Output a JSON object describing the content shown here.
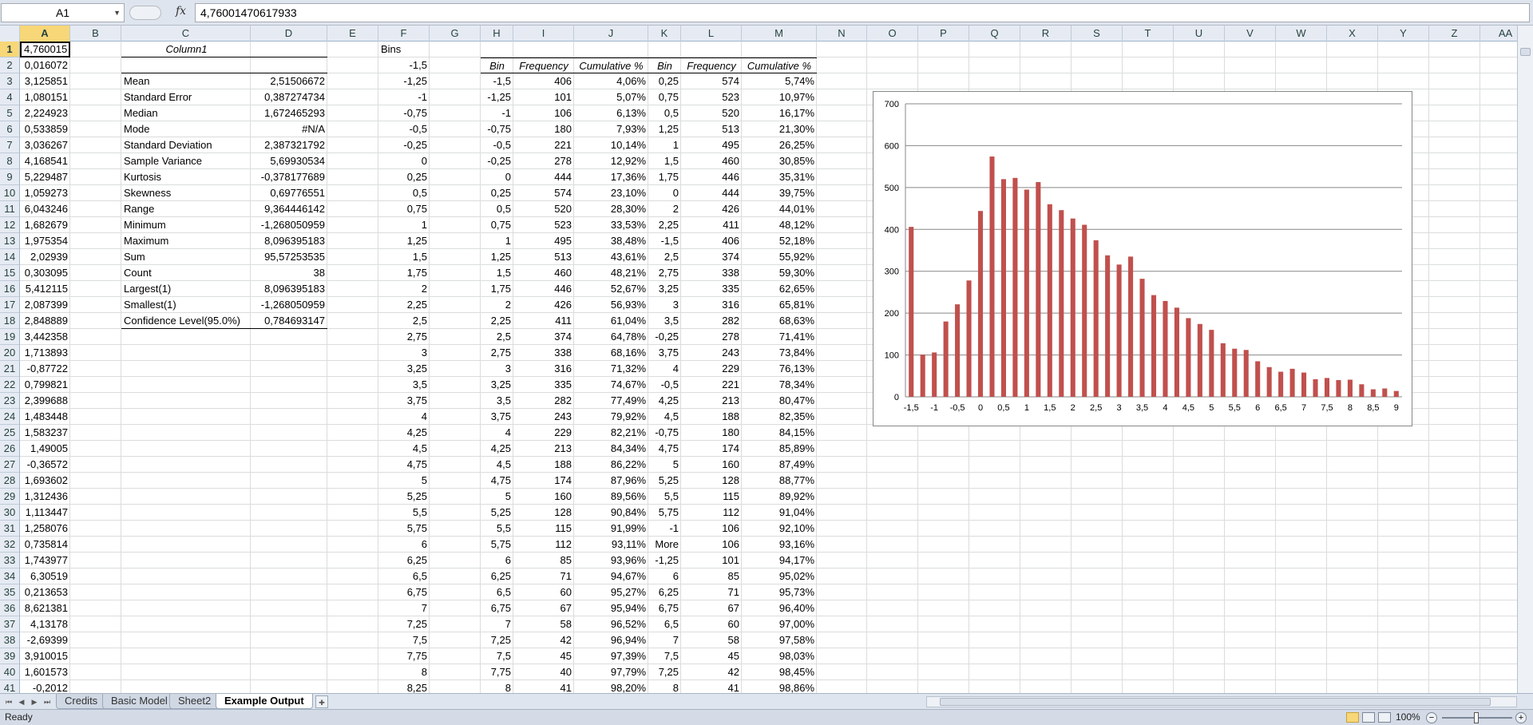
{
  "formula_bar": {
    "name_box": "A1",
    "fx_label": "fx",
    "formula": "4,76001470617933"
  },
  "columns": [
    "A",
    "B",
    "C",
    "D",
    "E",
    "F",
    "G",
    "H",
    "I",
    "J",
    "K",
    "L",
    "M",
    "N",
    "O",
    "P",
    "Q",
    "R",
    "S",
    "T",
    "U",
    "V",
    "W",
    "X",
    "Y",
    "Z",
    "AA"
  ],
  "rows": [
    "1",
    "2",
    "3",
    "4",
    "5",
    "6",
    "7",
    "8",
    "9",
    "10",
    "11",
    "12",
    "13",
    "14",
    "15",
    "16",
    "17",
    "18",
    "19",
    "20",
    "21",
    "22",
    "23",
    "24",
    "25",
    "26",
    "27",
    "28",
    "29",
    "30",
    "31",
    "32",
    "33",
    "34",
    "35",
    "36",
    "37",
    "38",
    "39",
    "40",
    "41"
  ],
  "colA": [
    "4,760015",
    "0,016072",
    "3,125851",
    "1,080151",
    "2,224923",
    "0,533859",
    "3,036267",
    "4,168541",
    "5,229487",
    "1,059273",
    "6,043246",
    "1,682679",
    "1,975354",
    "2,02939",
    "0,303095",
    "5,412115",
    "2,087399",
    "2,848889",
    "3,442358",
    "1,713893",
    "-0,87722",
    "0,799821",
    "2,399688",
    "1,483448",
    "1,583237",
    "1,49005",
    "-0,36572",
    "1,693602",
    "1,312436",
    "1,113447",
    "1,258076",
    "0,735814",
    "1,743977",
    "6,30519",
    "0,213653",
    "8,621381",
    "4,13178",
    "-2,69399",
    "3,910015",
    "1,601573",
    "-0,2012"
  ],
  "stats": {
    "header": "Column1",
    "labels": [
      "Mean",
      "Standard Error",
      "Median",
      "Mode",
      "Standard Deviation",
      "Sample Variance",
      "Kurtosis",
      "Skewness",
      "Range",
      "Minimum",
      "Maximum",
      "Sum",
      "Count",
      "Largest(1)",
      "Smallest(1)",
      "Confidence Level(95.0%)"
    ],
    "values": [
      "2,51506672",
      "0,387274734",
      "1,672465293",
      "#N/A",
      "2,387321792",
      "5,69930534",
      "-0,378177689",
      "0,69776551",
      "9,364446142",
      "-1,268050959",
      "8,096395183",
      "95,57253535",
      "38",
      "8,096395183",
      "-1,268050959",
      "0,784693147"
    ]
  },
  "bins": {
    "header": "Bins",
    "values": [
      "-1,5",
      "-1,25",
      "-1",
      "-0,75",
      "-0,5",
      "-0,25",
      "0",
      "0,25",
      "0,5",
      "0,75",
      "1",
      "1,25",
      "1,5",
      "1,75",
      "2",
      "2,25",
      "2,5",
      "2,75",
      "3",
      "3,25",
      "3,5",
      "3,75",
      "4",
      "4,25",
      "4,5",
      "4,75",
      "5",
      "5,25",
      "5,5",
      "5,75",
      "6",
      "6,25",
      "6,5",
      "6,75",
      "7",
      "7,25",
      "7,5",
      "7,75",
      "8",
      "8,25"
    ]
  },
  "hist1": {
    "headers": [
      "Bin",
      "Frequency",
      "Cumulative %"
    ],
    "bin": [
      "-1,5",
      "-1,25",
      "-1",
      "-0,75",
      "-0,5",
      "-0,25",
      "0",
      "0,25",
      "0,5",
      "0,75",
      "1",
      "1,25",
      "1,5",
      "1,75",
      "2",
      "2,25",
      "2,5",
      "2,75",
      "3",
      "3,25",
      "3,5",
      "3,75",
      "4",
      "4,25",
      "4,5",
      "4,75",
      "5",
      "5,25",
      "5,5",
      "5,75",
      "6",
      "6,25",
      "6,5",
      "6,75",
      "7",
      "7,25",
      "7,5",
      "7,75",
      "8"
    ],
    "freq": [
      "406",
      "101",
      "106",
      "180",
      "221",
      "278",
      "444",
      "574",
      "520",
      "523",
      "495",
      "513",
      "460",
      "446",
      "426",
      "411",
      "374",
      "338",
      "316",
      "335",
      "282",
      "243",
      "229",
      "213",
      "188",
      "174",
      "160",
      "128",
      "115",
      "112",
      "85",
      "71",
      "60",
      "67",
      "58",
      "42",
      "45",
      "40",
      "41"
    ],
    "cum": [
      "4,06%",
      "5,07%",
      "6,13%",
      "7,93%",
      "10,14%",
      "12,92%",
      "17,36%",
      "23,10%",
      "28,30%",
      "33,53%",
      "38,48%",
      "43,61%",
      "48,21%",
      "52,67%",
      "56,93%",
      "61,04%",
      "64,78%",
      "68,16%",
      "71,32%",
      "74,67%",
      "77,49%",
      "79,92%",
      "82,21%",
      "84,34%",
      "86,22%",
      "87,96%",
      "89,56%",
      "90,84%",
      "91,99%",
      "93,11%",
      "93,96%",
      "94,67%",
      "95,27%",
      "95,94%",
      "96,52%",
      "96,94%",
      "97,39%",
      "97,79%",
      "98,20%"
    ]
  },
  "hist2": {
    "headers": [
      "Bin",
      "Frequency",
      "Cumulative %"
    ],
    "bin": [
      "0,25",
      "0,75",
      "0,5",
      "1,25",
      "1",
      "1,5",
      "1,75",
      "0",
      "2",
      "2,25",
      "-1,5",
      "2,5",
      "2,75",
      "3,25",
      "3",
      "3,5",
      "-0,25",
      "3,75",
      "4",
      "-0,5",
      "4,25",
      "4,5",
      "-0,75",
      "4,75",
      "5",
      "5,25",
      "5,5",
      "5,75",
      "-1",
      "More",
      "-1,25",
      "6",
      "6,25",
      "6,75",
      "6,5",
      "7",
      "7,5",
      "7,25",
      "8"
    ],
    "freq": [
      "574",
      "523",
      "520",
      "513",
      "495",
      "460",
      "446",
      "444",
      "426",
      "411",
      "406",
      "374",
      "338",
      "335",
      "316",
      "282",
      "278",
      "243",
      "229",
      "221",
      "213",
      "188",
      "180",
      "174",
      "160",
      "128",
      "115",
      "112",
      "106",
      "106",
      "101",
      "85",
      "71",
      "67",
      "60",
      "58",
      "45",
      "42",
      "41"
    ],
    "cum": [
      "5,74%",
      "10,97%",
      "16,17%",
      "21,30%",
      "26,25%",
      "30,85%",
      "35,31%",
      "39,75%",
      "44,01%",
      "48,12%",
      "52,18%",
      "55,92%",
      "59,30%",
      "62,65%",
      "65,81%",
      "68,63%",
      "71,41%",
      "73,84%",
      "76,13%",
      "78,34%",
      "80,47%",
      "82,35%",
      "84,15%",
      "85,89%",
      "87,49%",
      "88,77%",
      "89,92%",
      "91,04%",
      "92,10%",
      "93,16%",
      "94,17%",
      "95,02%",
      "95,73%",
      "96,40%",
      "97,00%",
      "97,58%",
      "98,03%",
      "98,45%",
      "98,86%"
    ]
  },
  "chart_data": {
    "type": "bar",
    "categories": [
      "-1,5",
      "-1,25",
      "-1",
      "-0,75",
      "-0,5",
      "-0,25",
      "0",
      "0,25",
      "0,5",
      "0,75",
      "1",
      "1,25",
      "1,5",
      "1,75",
      "2",
      "2,25",
      "2,5",
      "2,75",
      "3",
      "3,25",
      "3,5",
      "3,75",
      "4",
      "4,25",
      "4,5",
      "4,75",
      "5",
      "5,25",
      "5,5",
      "5,75",
      "6",
      "6,25",
      "6,5",
      "6,75",
      "7",
      "7,25",
      "7,5",
      "7,75",
      "8",
      "8,25",
      "8,5",
      "8,75",
      "9"
    ],
    "values": [
      406,
      101,
      106,
      180,
      221,
      278,
      444,
      574,
      520,
      523,
      495,
      513,
      460,
      446,
      426,
      411,
      374,
      338,
      316,
      335,
      282,
      243,
      229,
      213,
      188,
      174,
      160,
      128,
      115,
      112,
      85,
      71,
      60,
      67,
      58,
      42,
      45,
      40,
      41,
      30,
      18,
      20,
      14
    ],
    "tick_labels": [
      "-1,5",
      "-1",
      "-0,5",
      "0",
      "0,5",
      "1",
      "1,5",
      "2",
      "2,5",
      "3",
      "3,5",
      "4",
      "4,5",
      "5",
      "5,5",
      "6",
      "6,5",
      "7",
      "7,5",
      "8",
      "8,5",
      "9"
    ],
    "y_ticks": [
      "0",
      "100",
      "200",
      "300",
      "400",
      "500",
      "600",
      "700"
    ],
    "ylim": [
      0,
      700
    ],
    "bar_color": "#c0504d",
    "grid": true
  },
  "sheets": [
    "Credits",
    "Basic Model",
    "Sheet2",
    "Example Output"
  ],
  "active_sheet": "Example Output",
  "status": "Ready",
  "zoom": "100%"
}
